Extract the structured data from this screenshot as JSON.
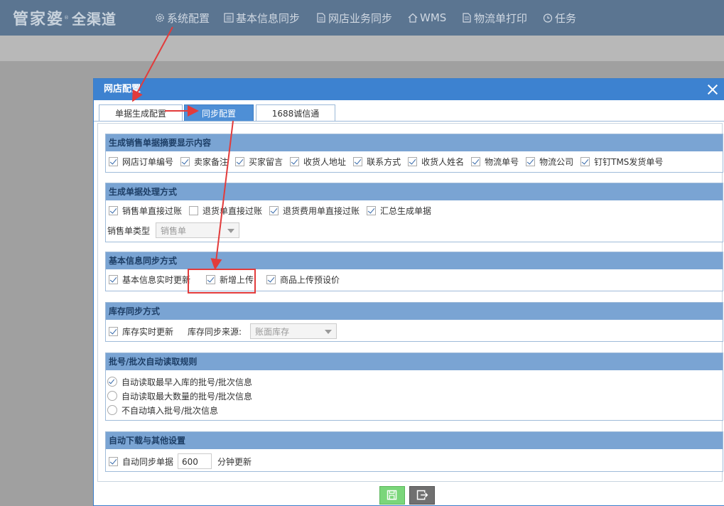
{
  "app": {
    "logo_main": "管家婆",
    "logo_reg": "®",
    "logo_sub": "全渠道"
  },
  "nav": [
    {
      "label": "系统配置",
      "icon": "gear-icon"
    },
    {
      "label": "基本信息同步",
      "icon": "list-icon"
    },
    {
      "label": "网店业务同步",
      "icon": "document-icon"
    },
    {
      "label": "WMS",
      "icon": "home-icon"
    },
    {
      "label": "物流单打印",
      "icon": "printer-doc-icon"
    },
    {
      "label": "任务",
      "icon": "clock-icon"
    }
  ],
  "dialog": {
    "title": "网店配置",
    "tabs": [
      "单据生成配置",
      "同步配置",
      "1688诚信通"
    ],
    "active_tab": "同步配置"
  },
  "group1": {
    "title": "生成销售单据摘要显示内容",
    "items": [
      {
        "label": "网店订单编号",
        "checked": true
      },
      {
        "label": "卖家备注",
        "checked": true
      },
      {
        "label": "买家留言",
        "checked": true
      },
      {
        "label": "收货人地址",
        "checked": true
      },
      {
        "label": "联系方式",
        "checked": true
      },
      {
        "label": "收货人姓名",
        "checked": true
      },
      {
        "label": "物流单号",
        "checked": true
      },
      {
        "label": "物流公司",
        "checked": true
      },
      {
        "label": "钉钉TMS发货单号",
        "checked": true
      }
    ]
  },
  "group2": {
    "title": "生成单据处理方式",
    "items": [
      {
        "label": "销售单直接过账",
        "checked": true
      },
      {
        "label": "退货单直接过账",
        "checked": false
      },
      {
        "label": "退货费用单直接过账",
        "checked": true
      },
      {
        "label": "汇总生成单据",
        "checked": true
      }
    ],
    "type_label": "销售单类型",
    "type_value": "销售单"
  },
  "group3": {
    "title": "基本信息同步方式",
    "items": [
      {
        "label": "基本信息实时更新",
        "checked": true
      },
      {
        "label": "新增上传",
        "checked": true
      },
      {
        "label": "商品上传预设价",
        "checked": true
      }
    ]
  },
  "group4": {
    "title": "库存同步方式",
    "realtime_label": "库存实时更新",
    "realtime_checked": true,
    "source_label": "库存同步来源:",
    "source_value": "账面库存"
  },
  "group5": {
    "title": "批号/批次自动读取规则",
    "options": [
      {
        "label": "自动读取最早入库的批号/批次信息",
        "selected": true
      },
      {
        "label": "自动读取最大数量的批号/批次信息",
        "selected": false
      },
      {
        "label": "不自动填入批号/批次信息",
        "selected": false
      }
    ]
  },
  "group6": {
    "title": "自动下载与其他设置",
    "auto_label": "自动同步单据",
    "auto_checked": true,
    "interval": "600",
    "unit": "分钟更新"
  },
  "colors": {
    "header": "#5b7591",
    "dialog_title": "#3d82d0",
    "group_head": "#7aa4d3",
    "annotation": "#e23b3b"
  }
}
